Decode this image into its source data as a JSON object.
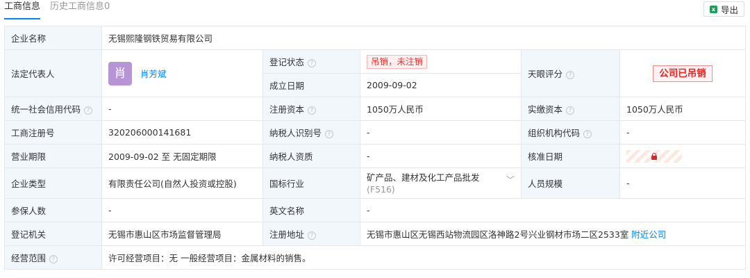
{
  "tabs": [
    {
      "label": "工商信息",
      "active": true
    },
    {
      "label": "历史工商信息0",
      "active": false
    }
  ],
  "toolbar": {
    "export_label": "导出",
    "export_icon": "excel-icon"
  },
  "info": {
    "company_name_label": "企业名称",
    "company_name": "无锡熙隆钢铁贸易有限公司",
    "legal_rep_label": "法定代表人",
    "legal_rep_avatar": "肖",
    "legal_rep_name": "肖芳斌",
    "reg_status_label": "登记状态",
    "reg_status": "吊销，未注销",
    "found_date_label": "成立日期",
    "found_date": "2009-09-02",
    "tianyan_label": "天眼评分",
    "tianyan_stamp": "公司已吊销",
    "credit_code_label": "统一社会信用代码",
    "credit_code": "-",
    "reg_capital_label": "注册资本",
    "reg_capital": "1050万人民币",
    "paid_capital_label": "实缴资本",
    "paid_capital": "1050万人民币",
    "reg_no_label": "工商注册号",
    "reg_no": "320206000141681",
    "taxpayer_id_label": "纳税人识别号",
    "taxpayer_id": "-",
    "org_code_label": "组织机构代码",
    "org_code": "-",
    "term_label": "营业期限",
    "term": "2009-09-02 至 无固定期限",
    "taxpayer_qual_label": "纳税人资质",
    "taxpayer_qual": "-",
    "approve_date_label": "核准日期",
    "type_label": "企业类型",
    "type": "有限责任公司(自然人投资或控股)",
    "industry_label": "国标行业",
    "industry": "矿产品、建材及化工产品批发",
    "industry_code": "(F516)",
    "staff_label": "人员规模",
    "staff": "-",
    "insured_label": "参保人数",
    "insured": "-",
    "english_name_label": "英文名称",
    "english_name": "-",
    "authority_label": "登记机关",
    "authority": "无锡市惠山区市场监督管理局",
    "address_label": "注册地址",
    "address": "无锡市惠山区无锡西站物流园区洛神路2号兴业钢材市场二区2533室",
    "nearby_label": "附近公司",
    "scope_label": "经营范围",
    "scope": "许可经营项目：无 一般经营项目：金属材料的销售。"
  },
  "colors": {
    "accent": "#0084ff",
    "label_bg": "#f2f7fc",
    "danger": "#e33333",
    "avatar": "#b794d6"
  }
}
